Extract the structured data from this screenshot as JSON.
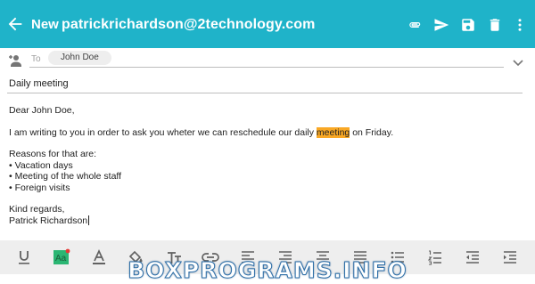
{
  "appbar": {
    "title": "New",
    "from_email": "patrickrichardson@2technology.com"
  },
  "recipients": {
    "to_label": "To",
    "chips": [
      "John Doe"
    ]
  },
  "subject": "Daily meeting",
  "body": {
    "greeting": "Dear John Doe,",
    "para_before": "I am writing to you in order to ask you wheter we can reschedule our daily ",
    "highlight": "meeting",
    "para_after": " on Friday.",
    "reasons_heading": "Reasons for that are:",
    "reasons": [
      "• Vacation days",
      "• Meeting of the whole staff",
      "• Foreign visits"
    ],
    "closing": "Kind regards,",
    "signature": "Patrick Richardson"
  },
  "colors": {
    "appbar": "#1fb3c9",
    "highlight": "#f9a825",
    "toolbar": "#eeeeee"
  },
  "icons": {
    "appbar": [
      "back-arrow-icon",
      "attachment-icon",
      "send-icon",
      "save-icon",
      "delete-icon",
      "more-vert-icon"
    ],
    "toolbar": [
      "underline-icon",
      "highlight-color-icon",
      "text-color-icon",
      "fill-color-icon",
      "text-size-icon",
      "link-icon",
      "align-left-icon",
      "align-right-icon",
      "align-center-icon",
      "align-justify-icon",
      "bulleted-list-icon",
      "numbered-list-icon",
      "outdent-icon",
      "indent-icon"
    ]
  },
  "watermark": "BOXPROGRAMS.INFO"
}
